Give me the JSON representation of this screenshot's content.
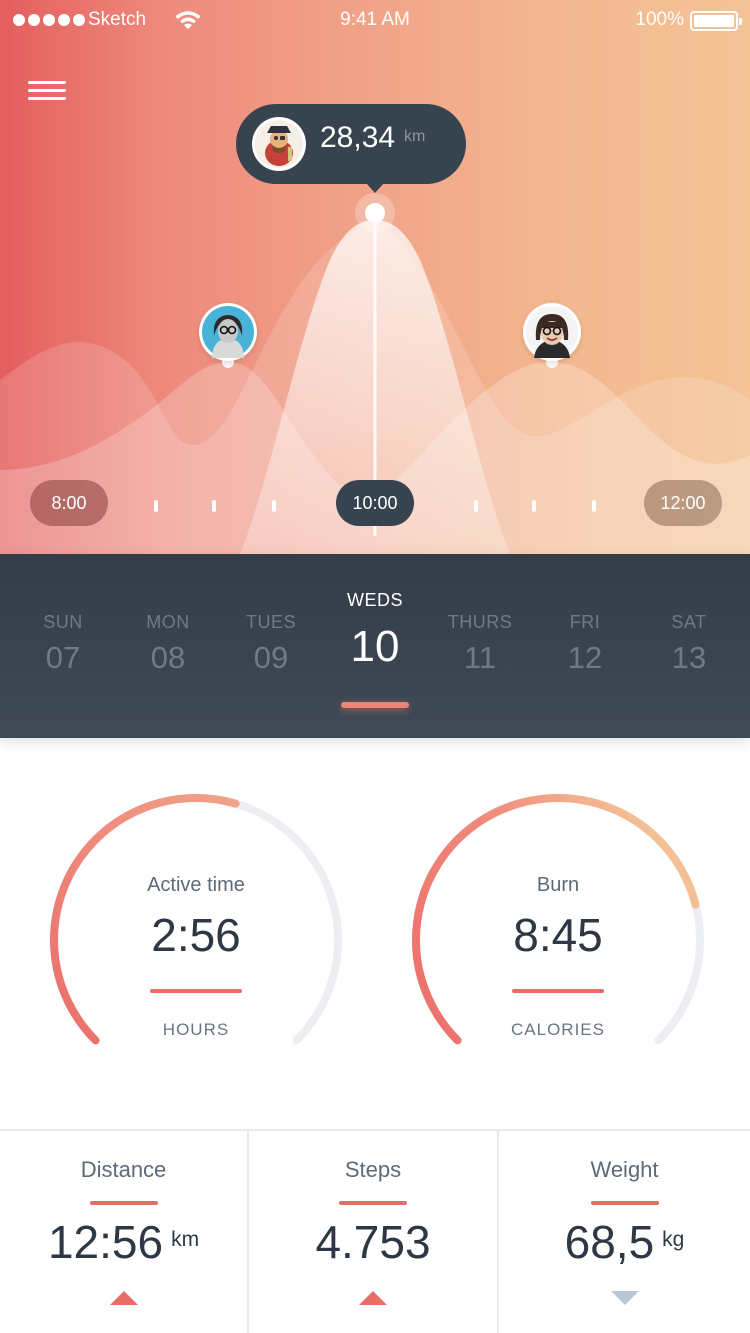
{
  "status_bar": {
    "carrier": "Sketch",
    "time": "9:41 AM",
    "battery": "100%"
  },
  "tooltip": {
    "value": "28,34",
    "unit": "km"
  },
  "timeline": {
    "start": "8:00",
    "current": "10:00",
    "end": "12:00"
  },
  "days": [
    {
      "name": "SUN",
      "num": "07"
    },
    {
      "name": "MON",
      "num": "08"
    },
    {
      "name": "TUES",
      "num": "09"
    },
    {
      "name": "WEDS",
      "num": "10"
    },
    {
      "name": "THURS",
      "num": "11"
    },
    {
      "name": "FRI",
      "num": "12"
    },
    {
      "name": "SAT",
      "num": "13"
    }
  ],
  "active_day_index": 3,
  "rings": {
    "active_time": {
      "label": "Active time",
      "value": "2:56",
      "unit": "HOURS",
      "progress": 0.56
    },
    "burn": {
      "label": "Burn",
      "value": "8:45",
      "unit": "CALORIES",
      "progress": 0.78
    }
  },
  "stats": {
    "distance": {
      "label": "Distance",
      "value": "12:56",
      "unit": "km",
      "trend": "up"
    },
    "steps": {
      "label": "Steps",
      "value": "4.753",
      "unit": "",
      "trend": "up"
    },
    "weight": {
      "label": "Weight",
      "value": "68,5",
      "unit": "kg",
      "trend": "down"
    }
  },
  "colors": {
    "accent": "#e66e66",
    "dark": "#37434f",
    "trend_up": "#e66e66",
    "trend_down": "#b8c6d6"
  }
}
